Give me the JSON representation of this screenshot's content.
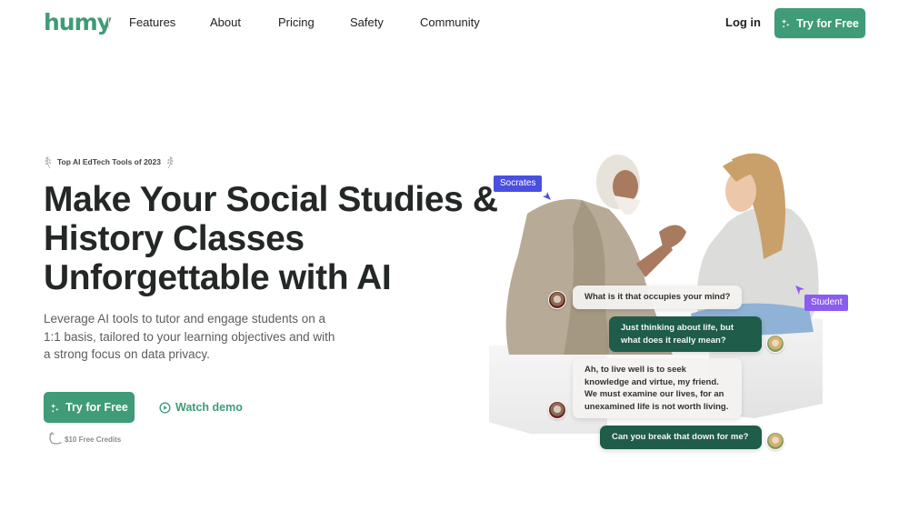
{
  "brand": {
    "logo_text": "humy",
    "accent_color": "#3f9b78",
    "dark_green": "#1f5c4a",
    "socrates_tag_color": "#4a4fe0",
    "student_tag_color": "#8b5cf0"
  },
  "nav": {
    "links": [
      {
        "label": "Features"
      },
      {
        "label": "About"
      },
      {
        "label": "Pricing"
      },
      {
        "label": "Safety"
      },
      {
        "label": "Community"
      }
    ],
    "login_label": "Log in",
    "cta_label": "Try for Free",
    "cta_icon": "sparkle-icon"
  },
  "hero": {
    "badge": {
      "text": "Top AI  EdTech Tools of 2023",
      "icon": "laurel-icon"
    },
    "headline_lines": [
      "Make Your Social Studies &",
      "History Classes",
      "Unforgettable with AI"
    ],
    "subtitle": "Leverage AI tools to tutor and engage students on a 1:1 basis, tailored to your learning objectives and with a strong focus on data privacy.",
    "cta_label": "Try for Free",
    "watch_label": "Watch demo",
    "watch_icon": "play-circle-icon",
    "credits_text": "$10 Free Credits"
  },
  "illustration": {
    "socrates_label": "Socrates",
    "student_label": "Student",
    "messages": [
      {
        "from": "socrates",
        "text": "What is it that occupies your mind?"
      },
      {
        "from": "student",
        "text": "Just thinking about life, but what does it really mean?"
      },
      {
        "from": "socrates",
        "text": "Ah, to live well is to seek knowledge and virtue, my friend. We must examine our lives, for an unexamined life is not worth living."
      },
      {
        "from": "student",
        "text": "Can you break that down for me?"
      }
    ]
  }
}
